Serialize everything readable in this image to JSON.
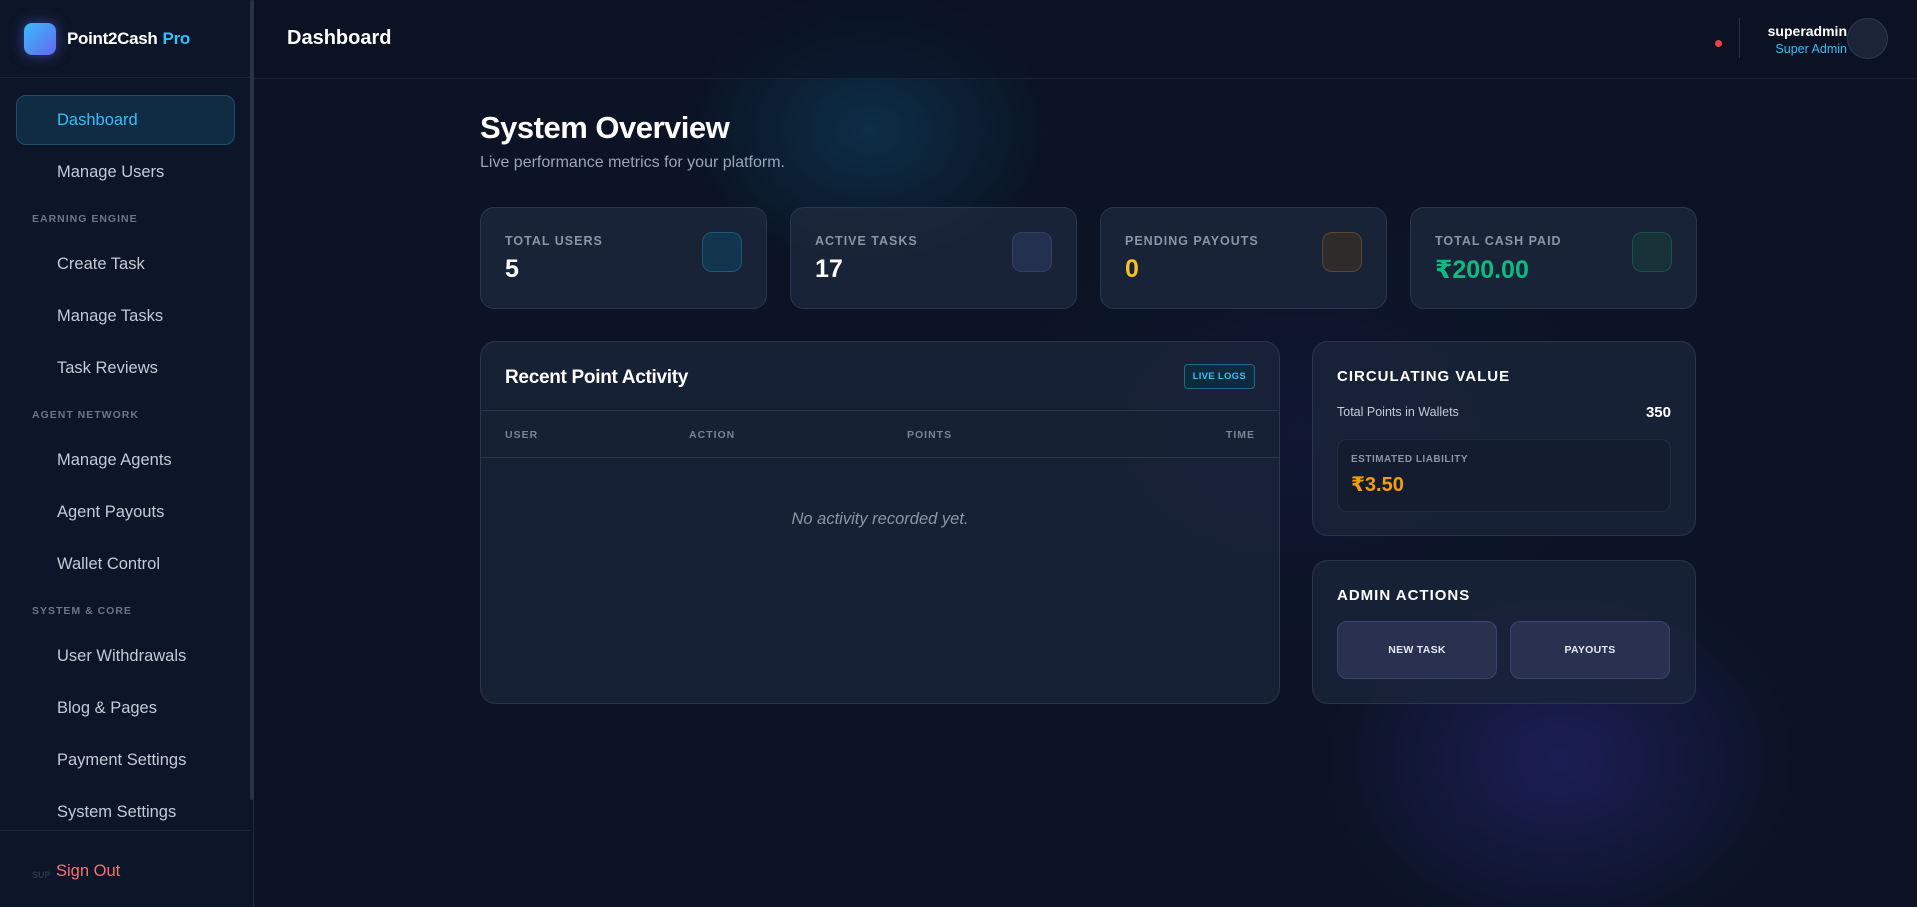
{
  "brand": {
    "name": "Point2Cash",
    "accent": "Pro"
  },
  "sidebar": {
    "top_items": [
      "Dashboard",
      "Manage Users"
    ],
    "sections": [
      {
        "title": "EARNING ENGINE",
        "items": [
          "Create Task",
          "Manage Tasks",
          "Task Reviews"
        ]
      },
      {
        "title": "AGENT NETWORK",
        "items": [
          "Manage Agents",
          "Agent Payouts",
          "Wallet Control"
        ]
      },
      {
        "title": "SYSTEM & CORE",
        "items": [
          "User Withdrawals",
          "Blog & Pages",
          "Payment Settings",
          "System Settings"
        ]
      }
    ],
    "sign_out": "Sign Out",
    "ghost_section": "SUP"
  },
  "header": {
    "title": "Dashboard",
    "user_name": "superadmin",
    "user_role": "Super Admin"
  },
  "overview": {
    "title": "System Overview",
    "subtitle": "Live performance metrics for your platform."
  },
  "stats": [
    {
      "label": "TOTAL USERS",
      "value": "5",
      "color": "#ffffff",
      "icon": "users-icon",
      "icon_bg": "#12364d",
      "icon_border": "#1f5878"
    },
    {
      "label": "ACTIVE TASKS",
      "value": "17",
      "color": "#ffffff",
      "icon": "tasks-icon",
      "icon_bg": "#23304f",
      "icon_border": "#33406a"
    },
    {
      "label": "PENDING PAYOUTS",
      "value": "0",
      "color": "#fbbf24",
      "icon": "clock-icon",
      "icon_bg": "#2f2b2a",
      "icon_border": "#5a4630"
    },
    {
      "label": "TOTAL CASH PAID",
      "value": "₹200.00",
      "color": "#10b981",
      "icon": "cash-icon",
      "icon_bg": "#163238",
      "icon_border": "#1f4e4a"
    }
  ],
  "activity": {
    "title": "Recent Point Activity",
    "badge": "LIVE LOGS",
    "columns": [
      "USER",
      "ACTION",
      "POINTS",
      "TIME"
    ],
    "empty": "No activity recorded yet."
  },
  "circulating": {
    "title": "CIRCULATING VALUE",
    "label": "Total Points in Wallets",
    "value": "350",
    "liability_label": "ESTIMATED LIABILITY",
    "liability_value": "₹3.50"
  },
  "admin_actions": {
    "title": "ADMIN ACTIONS",
    "buttons": [
      "NEW TASK",
      "PAYOUTS"
    ]
  }
}
